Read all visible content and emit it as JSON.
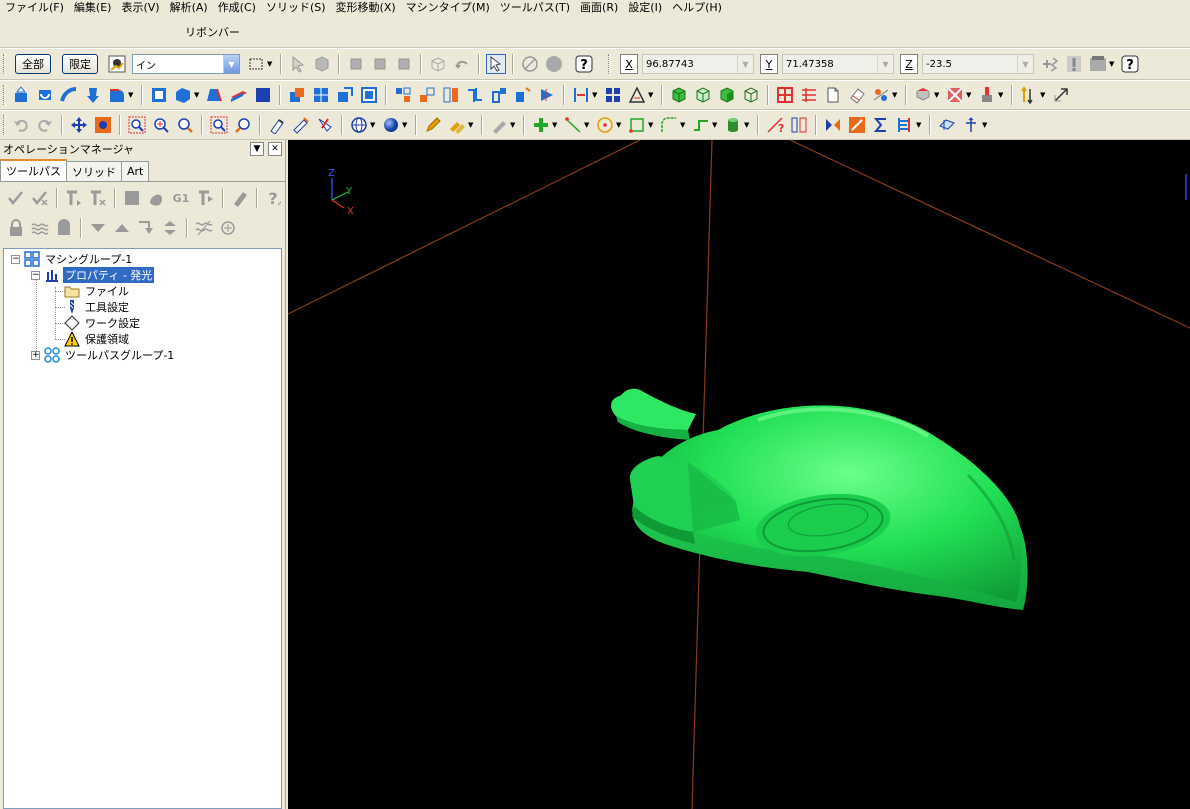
{
  "menu": [
    "ファイル(F)",
    "編集(E)",
    "表示(V)",
    "解析(A)",
    "作成(C)",
    "ソリッド(S)",
    "変形移動(X)",
    "マシンタイプ(M)",
    "ツールパス(T)",
    "画面(R)",
    "設定(I)",
    "ヘルプ(H)"
  ],
  "ribbon": {
    "label": "リボンバー"
  },
  "toolbar1": {
    "all_button": "全部",
    "limit_button": "限定",
    "mode_select": "イン",
    "coord_x_label": "X",
    "coord_x_value": "96.87743",
    "coord_y_label": "Y",
    "coord_y_value": "71.47358",
    "coord_z_label": "Z",
    "coord_z_value": "-23.5"
  },
  "op_manager": {
    "title": "オペレーションマネージャ",
    "tabs": [
      "ツールパス",
      "ソリッド",
      "Art"
    ],
    "active_tab": "ツールパス",
    "tool_g1": "G1"
  },
  "tree": {
    "machine_group": "マシングループ-1",
    "properties": "プロパティ - 発光",
    "file": "ファイル",
    "tool_settings": "工具設定",
    "work_settings": "ワーク設定",
    "protected_area": "保護領域",
    "toolpath_group": "ツールパスグループ-1"
  },
  "viewport": {
    "background": "#000000",
    "model_color": "#22e055",
    "axis_line_color": "#8b3a1a",
    "triad": {
      "z": "Z",
      "y": "Y",
      "x": "X"
    },
    "triad_colors": {
      "z": "#3b5bff",
      "y": "#22c24a",
      "x": "#e23030"
    }
  },
  "colors": {
    "chrome": "#ece9d8",
    "selection": "#316ac5",
    "tab_accent": "#e68b2c"
  }
}
